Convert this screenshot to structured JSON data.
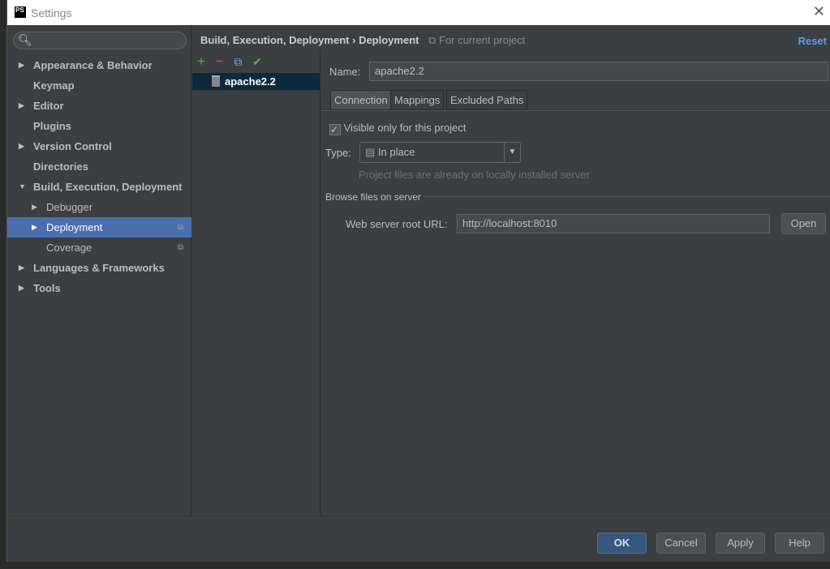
{
  "window": {
    "title": "Settings",
    "logo": "PS",
    "close_icon": "close-icon"
  },
  "search": {
    "placeholder": ""
  },
  "sidebar": {
    "items": [
      {
        "label": "Appearance & Behavior",
        "arrow": "▶"
      },
      {
        "label": "Keymap",
        "arrow": ""
      },
      {
        "label": "Editor",
        "arrow": "▶"
      },
      {
        "label": "Plugins",
        "arrow": ""
      },
      {
        "label": "Version Control",
        "arrow": "▶"
      },
      {
        "label": "Directories",
        "arrow": ""
      },
      {
        "label": "Build, Execution, Deployment",
        "arrow": "▼"
      },
      {
        "label": "Debugger",
        "arrow": "▶"
      },
      {
        "label": "Deployment",
        "arrow": "▶"
      },
      {
        "label": "Coverage",
        "arrow": ""
      },
      {
        "label": "Languages & Frameworks",
        "arrow": "▶"
      },
      {
        "label": "Tools",
        "arrow": "▶"
      }
    ]
  },
  "breadcrumb": {
    "parent": "Build, Execution, Deployment",
    "sep": "›",
    "current": "Deployment",
    "scope": "For current project",
    "reset": "Reset"
  },
  "servers": [
    "apache2.2"
  ],
  "form": {
    "name_label": "Name:",
    "name_value": "apache2.2",
    "tabs": [
      "Connection",
      "Mappings",
      "Excluded Paths"
    ],
    "visible_only": "Visible only for this project",
    "visible_checked": true,
    "type_label": "Type:",
    "type_value": "In place",
    "type_hint": "Project files are already on locally installed server",
    "browse_section": "Browse files on server",
    "url_label": "Web server root URL:",
    "url_value": "http://localhost:8010",
    "open": "Open"
  },
  "buttons": {
    "ok": "OK",
    "cancel": "Cancel",
    "apply": "Apply",
    "help": "Help"
  }
}
